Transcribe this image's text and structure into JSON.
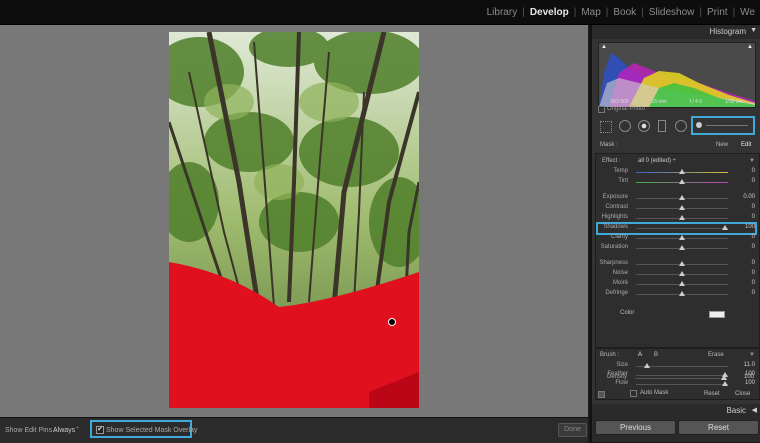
{
  "modules": [
    "Library",
    "Develop",
    "Map",
    "Book",
    "Slideshow",
    "Print",
    "We"
  ],
  "active_module": "Develop",
  "bottom_toolbar": {
    "edit_pins_label": "Show Edit Pins :",
    "edit_pins_value": "Always",
    "show_overlay_label": "Show Selected Mask Overlay",
    "show_overlay_checked": "✔",
    "done_label": "Done"
  },
  "histogram": {
    "title": "Histogram",
    "iso": "ISO 500",
    "focal": "15 mm",
    "aperture": "f / 4.0",
    "shutter": "1/30 sec",
    "original_photo_label": "Original Photo"
  },
  "mask": {
    "label": "Mask :",
    "new": "New",
    "edit": "Edit"
  },
  "effect": {
    "label": "Effect :",
    "value": "all 0 (edited) ÷",
    "sliders": [
      {
        "label": "Temp",
        "value": "0"
      },
      {
        "label": "Tint",
        "value": "0"
      },
      {
        "label": "Exposure",
        "value": "0.00"
      },
      {
        "label": "Contrast",
        "value": "0"
      },
      {
        "label": "Highlights",
        "value": "0"
      },
      {
        "label": "Shadows",
        "value": "100"
      },
      {
        "label": "Clarity",
        "value": "0"
      },
      {
        "label": "Saturation",
        "value": "0"
      },
      {
        "label": "Sharpness",
        "value": "0"
      },
      {
        "label": "Noise",
        "value": "0"
      },
      {
        "label": "Moiré",
        "value": "0"
      },
      {
        "label": "Defringe",
        "value": "0"
      }
    ],
    "color_label": "Color"
  },
  "brush": {
    "label": "Brush :",
    "a": "A",
    "b": "B",
    "erase": "Erase",
    "size_label": "Size",
    "size_value": "11.0",
    "feather_label": "Feather",
    "feather_value": "100",
    "flow_label": "Flow",
    "flow_value": "100",
    "auto_mask_label": "Auto Mask",
    "density_label": "Density",
    "density_value": "100"
  },
  "panel_footer": {
    "reset": "Reset",
    "close": "Close"
  },
  "basic_header": "Basic",
  "previous_label": "Previous",
  "reset_label": "Reset",
  "accent_color": "#3fa9d9",
  "mask_overlay_color": "#e0101e"
}
